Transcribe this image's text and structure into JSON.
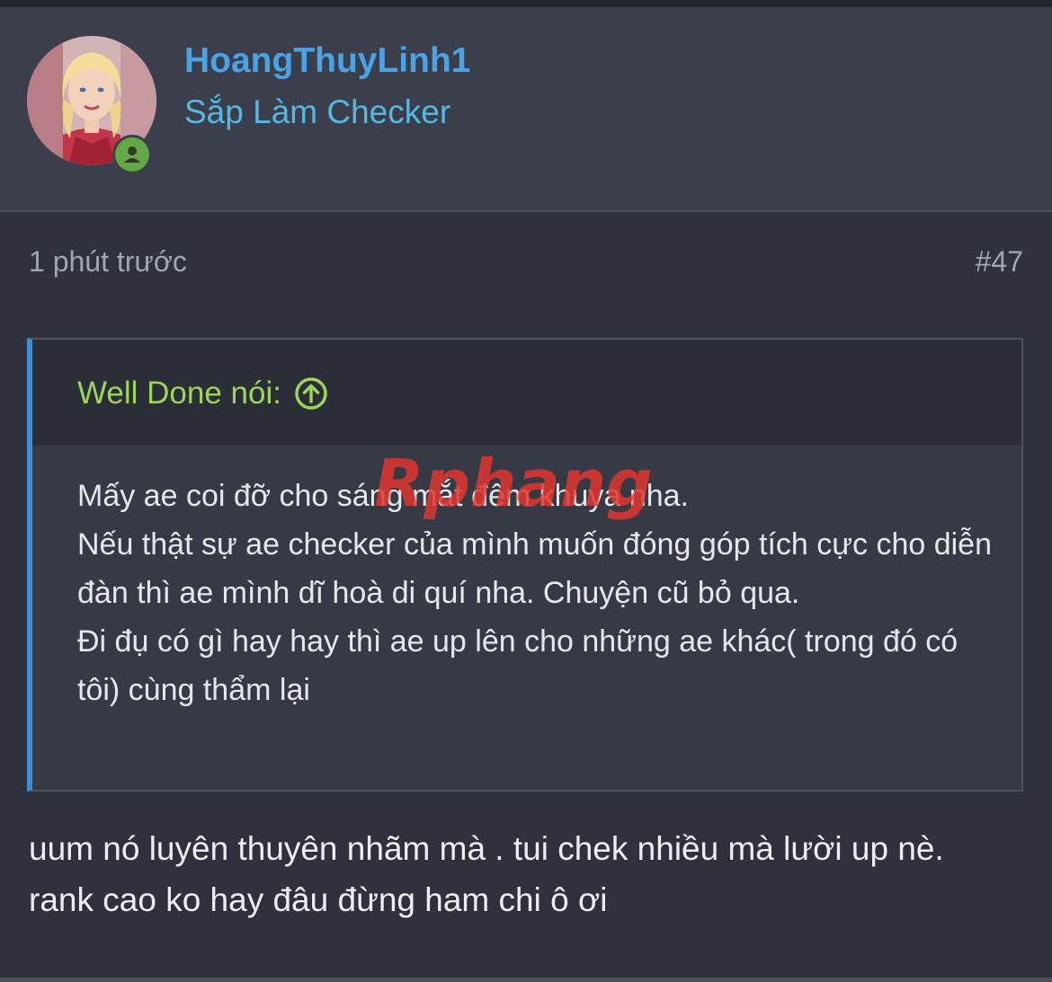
{
  "user": {
    "name": "HoangThuyLinh1",
    "title": "Sắp Làm Checker",
    "status": "online"
  },
  "post": {
    "time": "1 phút trước",
    "number": "#47"
  },
  "quote": {
    "author": "Well Done nói:",
    "lines": [
      "Mấy ae coi đỡ cho sáng mắt đêm khuya nha.",
      "Nếu thật sự ae checker của mình muốn đóng góp tích cực cho diễn đàn thì ae mình dĩ hoà di quí nha. Chuyện cũ bỏ qua.",
      "Đi đụ có gì hay hay thì ae up lên cho những ae khác( trong đó có tôi) cùng thẩm lại"
    ]
  },
  "reply": "uum nó luyên thuyên nhãm mà . tui chek nhiều mà lười up nè. rank cao ko hay đâu đừng ham chi ô ơi",
  "watermark": "Rphang",
  "colors": {
    "username": "#4aa3e6",
    "title": "#56b7e3",
    "quote_author": "#9ed45e",
    "quote_bar": "#3a8fd6",
    "online": "#63a844"
  },
  "icons": {
    "online": "user-online-icon",
    "jump": "arrow-up-circle-icon"
  }
}
